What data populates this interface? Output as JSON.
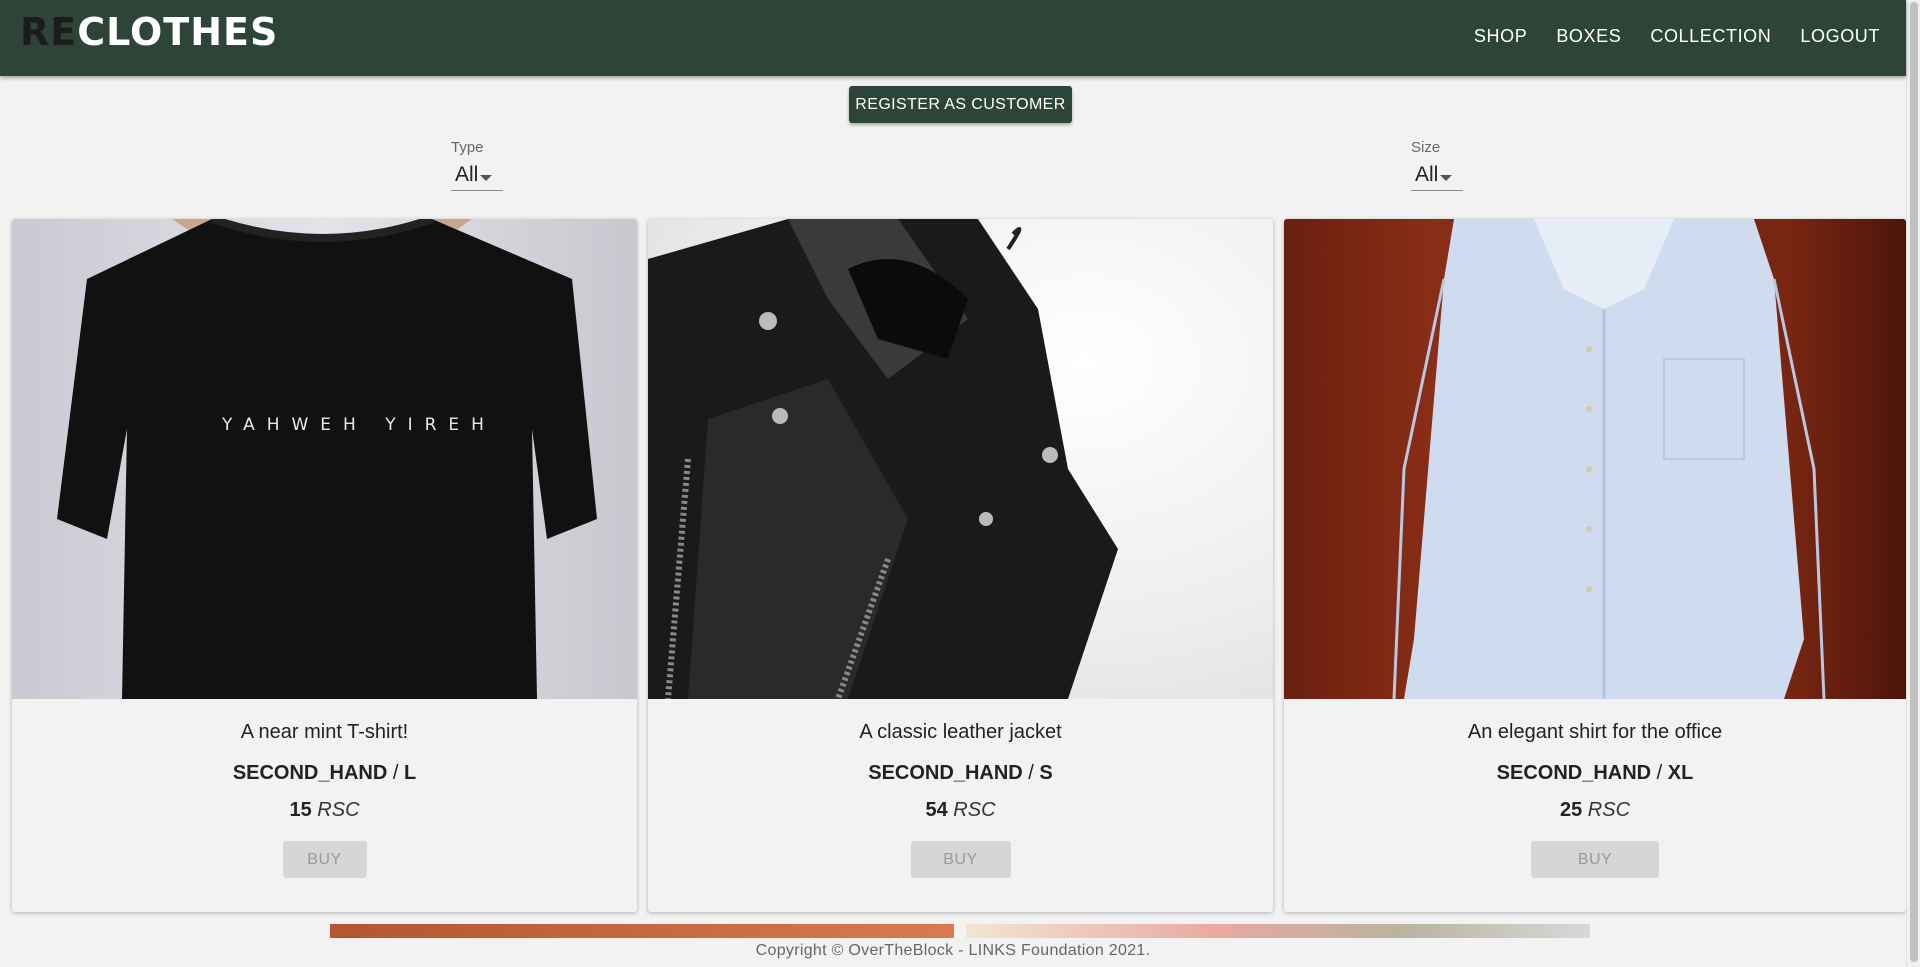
{
  "header": {
    "logo_re": "RE",
    "logo_clothes": "CLOTHES",
    "nav": {
      "shop": "SHOP",
      "boxes": "BOXES",
      "collection": "COLLECTION",
      "logout": "LOGOUT"
    }
  },
  "register_button": "REGISTER AS CUSTOMER",
  "filters": {
    "type": {
      "label": "Type",
      "value": "All"
    },
    "size": {
      "label": "Size",
      "value": "All"
    }
  },
  "products": [
    {
      "title": "A near mint T-shirt!",
      "condition": "SECOND_HAND",
      "size": "L",
      "price": "15",
      "currency": "RSC",
      "buy_label": "BUY",
      "image_icon": "black-tshirt-photo"
    },
    {
      "title": "A classic leather jacket",
      "condition": "SECOND_HAND",
      "size": "S",
      "price": "54",
      "currency": "RSC",
      "buy_label": "BUY",
      "image_icon": "leather-jacket-photo"
    },
    {
      "title": "An elegant shirt for the office",
      "condition": "SECOND_HAND",
      "size": "XL",
      "price": "25",
      "currency": "RSC",
      "buy_label": "BUY",
      "image_icon": "light-blue-shirt-photo"
    }
  ],
  "tshirt_print": "YAHWEH YIREH",
  "footer": "Copyright © OverTheBlock - LINKS Foundation 2021.",
  "colors": {
    "primary": "#2d4538",
    "background": "#f2f2f2",
    "buy_disabled": "#d6d6d6"
  }
}
